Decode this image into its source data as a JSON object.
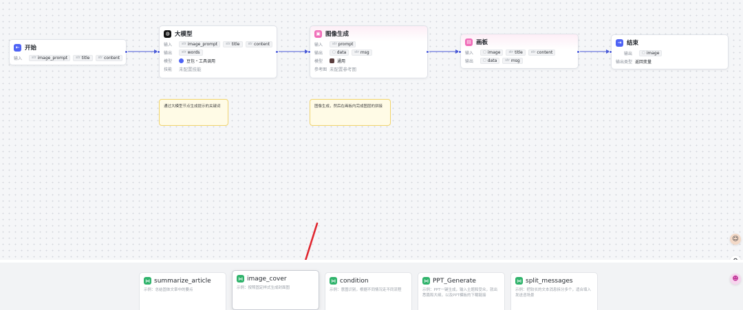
{
  "nodes": {
    "start": {
      "title": "开始",
      "input_label": "输入",
      "params": [
        "image_prompt",
        "title",
        "content"
      ]
    },
    "llm": {
      "title": "大模型",
      "input_label": "输入",
      "inputs": [
        "image_prompt",
        "title",
        "content"
      ],
      "output_label": "输出",
      "outputs": [
        "words"
      ],
      "model_label": "模型",
      "model_value": "豆包・工具调用",
      "skill_label": "技能",
      "skill_value": "未配置技能"
    },
    "image_gen": {
      "title": "图像生成",
      "input_label": "输入",
      "inputs": [
        "prompt"
      ],
      "output_label": "输出",
      "outputs": [
        "data",
        "msg"
      ],
      "model_label": "模型",
      "model_value": "通用",
      "ref_label": "参考图",
      "ref_value": "未配置参考图"
    },
    "canvas": {
      "title": "画板",
      "input_label": "输入",
      "inputs": [
        "image",
        "title",
        "content"
      ],
      "output_label": "输出",
      "outputs": [
        "data",
        "msg"
      ]
    },
    "end": {
      "title": "结束",
      "output_label": "输出",
      "outputs": [
        "image"
      ],
      "answer_type_label": "输出类型",
      "answer_type_value": "返回变量"
    }
  },
  "notes": [
    "通过大模型节点生成提示的关键词",
    "图像生成，然后在画板内完成图层的拼接"
  ],
  "templates": [
    {
      "title": "summarize_article",
      "desc": "示例：总结固体文章中的要点"
    },
    {
      "title": "image_cover",
      "desc": "示例：按照固定样式生成封面图"
    },
    {
      "title": "condition",
      "desc": "示例：意图识别，根据不同情况走不同流程"
    },
    {
      "title": "PPT_Generate",
      "desc": "示例：PPT一键生成，输入主题和受众，就出悉篇和大纲，以及PPT模板的下载链接"
    },
    {
      "title": "split_messages",
      "desc": "示例：把较长的文本消息拆分多个，适合填入发送咨场景"
    }
  ],
  "colors": {
    "start_icon": "#4e63f5",
    "llm_icon": "#111111",
    "image_icon": "#f06bb8",
    "canvas_icon": "#f06bb8",
    "end_icon": "#4e63f5",
    "edge": "#4a5bd8",
    "note_bg": "#fffbe6",
    "template_icon": "#2fb36b",
    "arrow": "#e0262f"
  },
  "icons": {
    "start": "start-arrow-icon",
    "llm": "llm-model-icon",
    "image_gen": "image-generate-icon",
    "canvas": "canvas-board-icon",
    "end": "end-exit-icon",
    "template": "workflow-share-icon"
  }
}
